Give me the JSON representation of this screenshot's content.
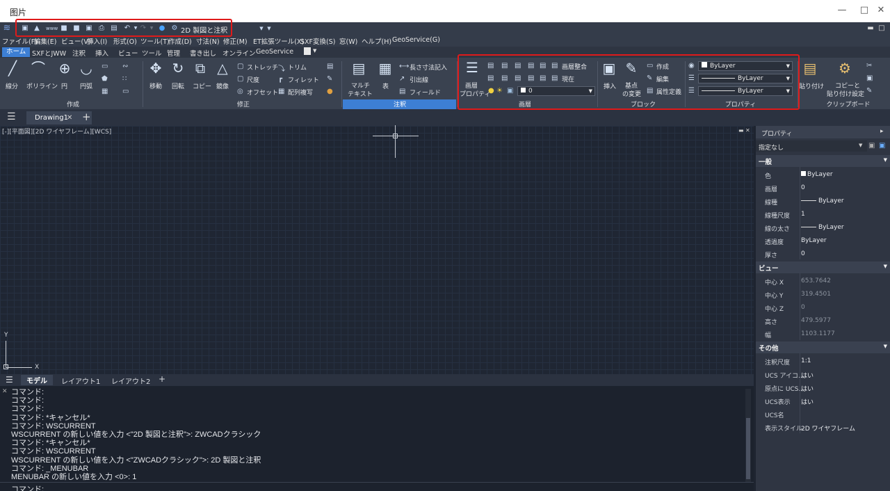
{
  "window": {
    "title": "图片"
  },
  "qat": {
    "workspace": "2D 製図と注釈"
  },
  "menubar": [
    "ファイル(F)",
    "編集(E)",
    "ビュー(V)",
    "挿入(I)",
    "形式(O)",
    "ツール(T)",
    "作成(D)",
    "寸法(N)",
    "修正(M)",
    "ET拡張ツール(X)",
    "SXF変換(S)",
    "窓(W)",
    "ヘルプ(H)",
    "GeoService(G)"
  ],
  "ribbon_tabs": [
    "ホーム",
    "SXFとJWW",
    "注釈",
    "挿入",
    "ビュー",
    "ツール",
    "管理",
    "書き出し",
    "オンライン",
    "GeoService"
  ],
  "create_panel": {
    "line": "線分",
    "polyline": "ポリライン",
    "circle": "円",
    "arc": "円弧",
    "title": "作成"
  },
  "modify_panel": {
    "move": "移動",
    "rotate": "回転",
    "copy": "コピー",
    "mirror": "鏡像",
    "stretch": "ストレッチ",
    "scale": "尺度",
    "offset": "オフセット",
    "trim": "トリム",
    "fillet": "フィレット",
    "array": "配列複写",
    "title": "修正"
  },
  "annotation_panel": {
    "mtext1": "マルチ",
    "mtext2": "テキスト",
    "table": "表",
    "dim": "長さ寸法記入",
    "leader": "引出線",
    "field": "フィールド",
    "title": "注釈"
  },
  "layer_panel": {
    "prop1": "画層",
    "prop2": "プロパティ",
    "match": "画層整合",
    "current": "現在",
    "layer": "0",
    "title": "画層"
  },
  "block_panel": {
    "insert": "挿入",
    "base1": "基点",
    "base2": "の変更",
    "create": "作成",
    "edit": "編集",
    "attdef": "属性定義",
    "title": "ブロック"
  },
  "props_panel": {
    "color": "ByLayer",
    "linetype": "ByLayer",
    "lineweight": "ByLayer",
    "title": "プロパティ"
  },
  "clipboard_panel": {
    "paste": "貼り付け",
    "copypaste1": "コピーと",
    "copypaste2": "貼り付け設定",
    "title": "クリップボード"
  },
  "doc_tab": "Drawing1",
  "viewport_label": "[-][平面図][2D ワイヤフレーム][WCS]",
  "axis": {
    "x": "X",
    "y": "Y"
  },
  "layout_tabs": [
    "モデル",
    "レイアウト1",
    "レイアウト2"
  ],
  "command_lines": [
    "コマンド:",
    "コマンド:",
    "コマンド:",
    "コマンド: *キャンセル*",
    "コマンド: WSCURRENT",
    "WSCURRENT の新しい値を入力 <\"2D 製図と注釈\">: ZWCADクラシック",
    "コマンド: *キャンセル*",
    "コマンド: WSCURRENT",
    "WSCURRENT の新しい値を入力 <\"ZWCADクラシック\">: 2D 製図と注釈",
    "コマンド: _MENUBAR",
    "MENUBAR の新しい値を入力 <0>: 1"
  ],
  "command_prompt": "コマンド:",
  "properties": {
    "title": "プロパティ",
    "selection": "指定なし",
    "general": {
      "title": "一般",
      "rows": [
        {
          "k": "色",
          "v": "ByLayer"
        },
        {
          "k": "画層",
          "v": "0"
        },
        {
          "k": "線種",
          "v": "ByLayer"
        },
        {
          "k": "線種尺度",
          "v": "1"
        },
        {
          "k": "線の太さ",
          "v": "ByLayer"
        },
        {
          "k": "透過度",
          "v": "ByLayer"
        },
        {
          "k": "厚さ",
          "v": "0"
        }
      ]
    },
    "view": {
      "title": "ビュー",
      "rows": [
        {
          "k": "中心 X",
          "v": "653.7642"
        },
        {
          "k": "中心 Y",
          "v": "319.4501"
        },
        {
          "k": "中心 Z",
          "v": "0"
        },
        {
          "k": "高さ",
          "v": "479.5977"
        },
        {
          "k": "幅",
          "v": "1103.1177"
        }
      ]
    },
    "misc": {
      "title": "その他",
      "rows": [
        {
          "k": "注釈尺度",
          "v": "1:1"
        },
        {
          "k": "UCS アイコ...",
          "v": "はい"
        },
        {
          "k": "原点に UCS...",
          "v": "はい"
        },
        {
          "k": "UCS表示",
          "v": "はい"
        },
        {
          "k": "UCS名",
          "v": ""
        },
        {
          "k": "表示スタイル",
          "v": "2D ワイヤフレーム"
        }
      ]
    }
  },
  "colors": {
    "accent": "#3d7fd4",
    "highlight_box": "#e01a1a"
  }
}
